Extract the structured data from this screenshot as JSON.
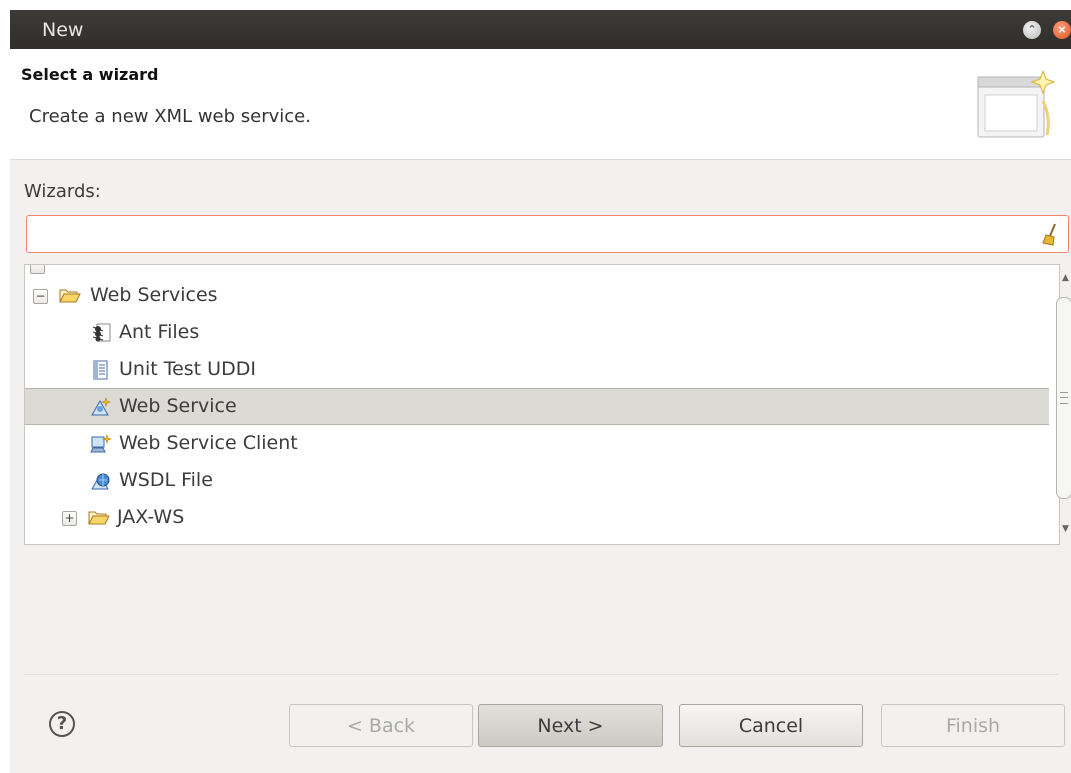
{
  "window": {
    "title": "New"
  },
  "header": {
    "title": "Select a wizard",
    "description": "Create a new XML web service."
  },
  "wizards": {
    "label": "Wizards:",
    "filter_value": "",
    "tree": [
      {
        "label": "Web Services",
        "icon": "folder-open-icon",
        "toggle": "−"
      },
      {
        "label": "Ant Files",
        "icon": "ant-icon"
      },
      {
        "label": "Unit Test UDDI",
        "icon": "document-icon"
      },
      {
        "label": "Web Service",
        "icon": "web-service-icon",
        "selected": true
      },
      {
        "label": "Web Service Client",
        "icon": "web-service-client-icon"
      },
      {
        "label": "WSDL File",
        "icon": "wsdl-icon"
      },
      {
        "label": "JAX-WS",
        "icon": "folder-open-icon",
        "toggle": "+"
      }
    ]
  },
  "buttons": {
    "help": "?",
    "back": "< Back",
    "next": "Next >",
    "cancel": "Cancel",
    "finish": "Finish"
  },
  "colors": {
    "titlebar": "#3c3b37",
    "dialog_bg": "#f2f1f0",
    "filter_border": "#f0846b",
    "selection": "#dcdad5"
  }
}
